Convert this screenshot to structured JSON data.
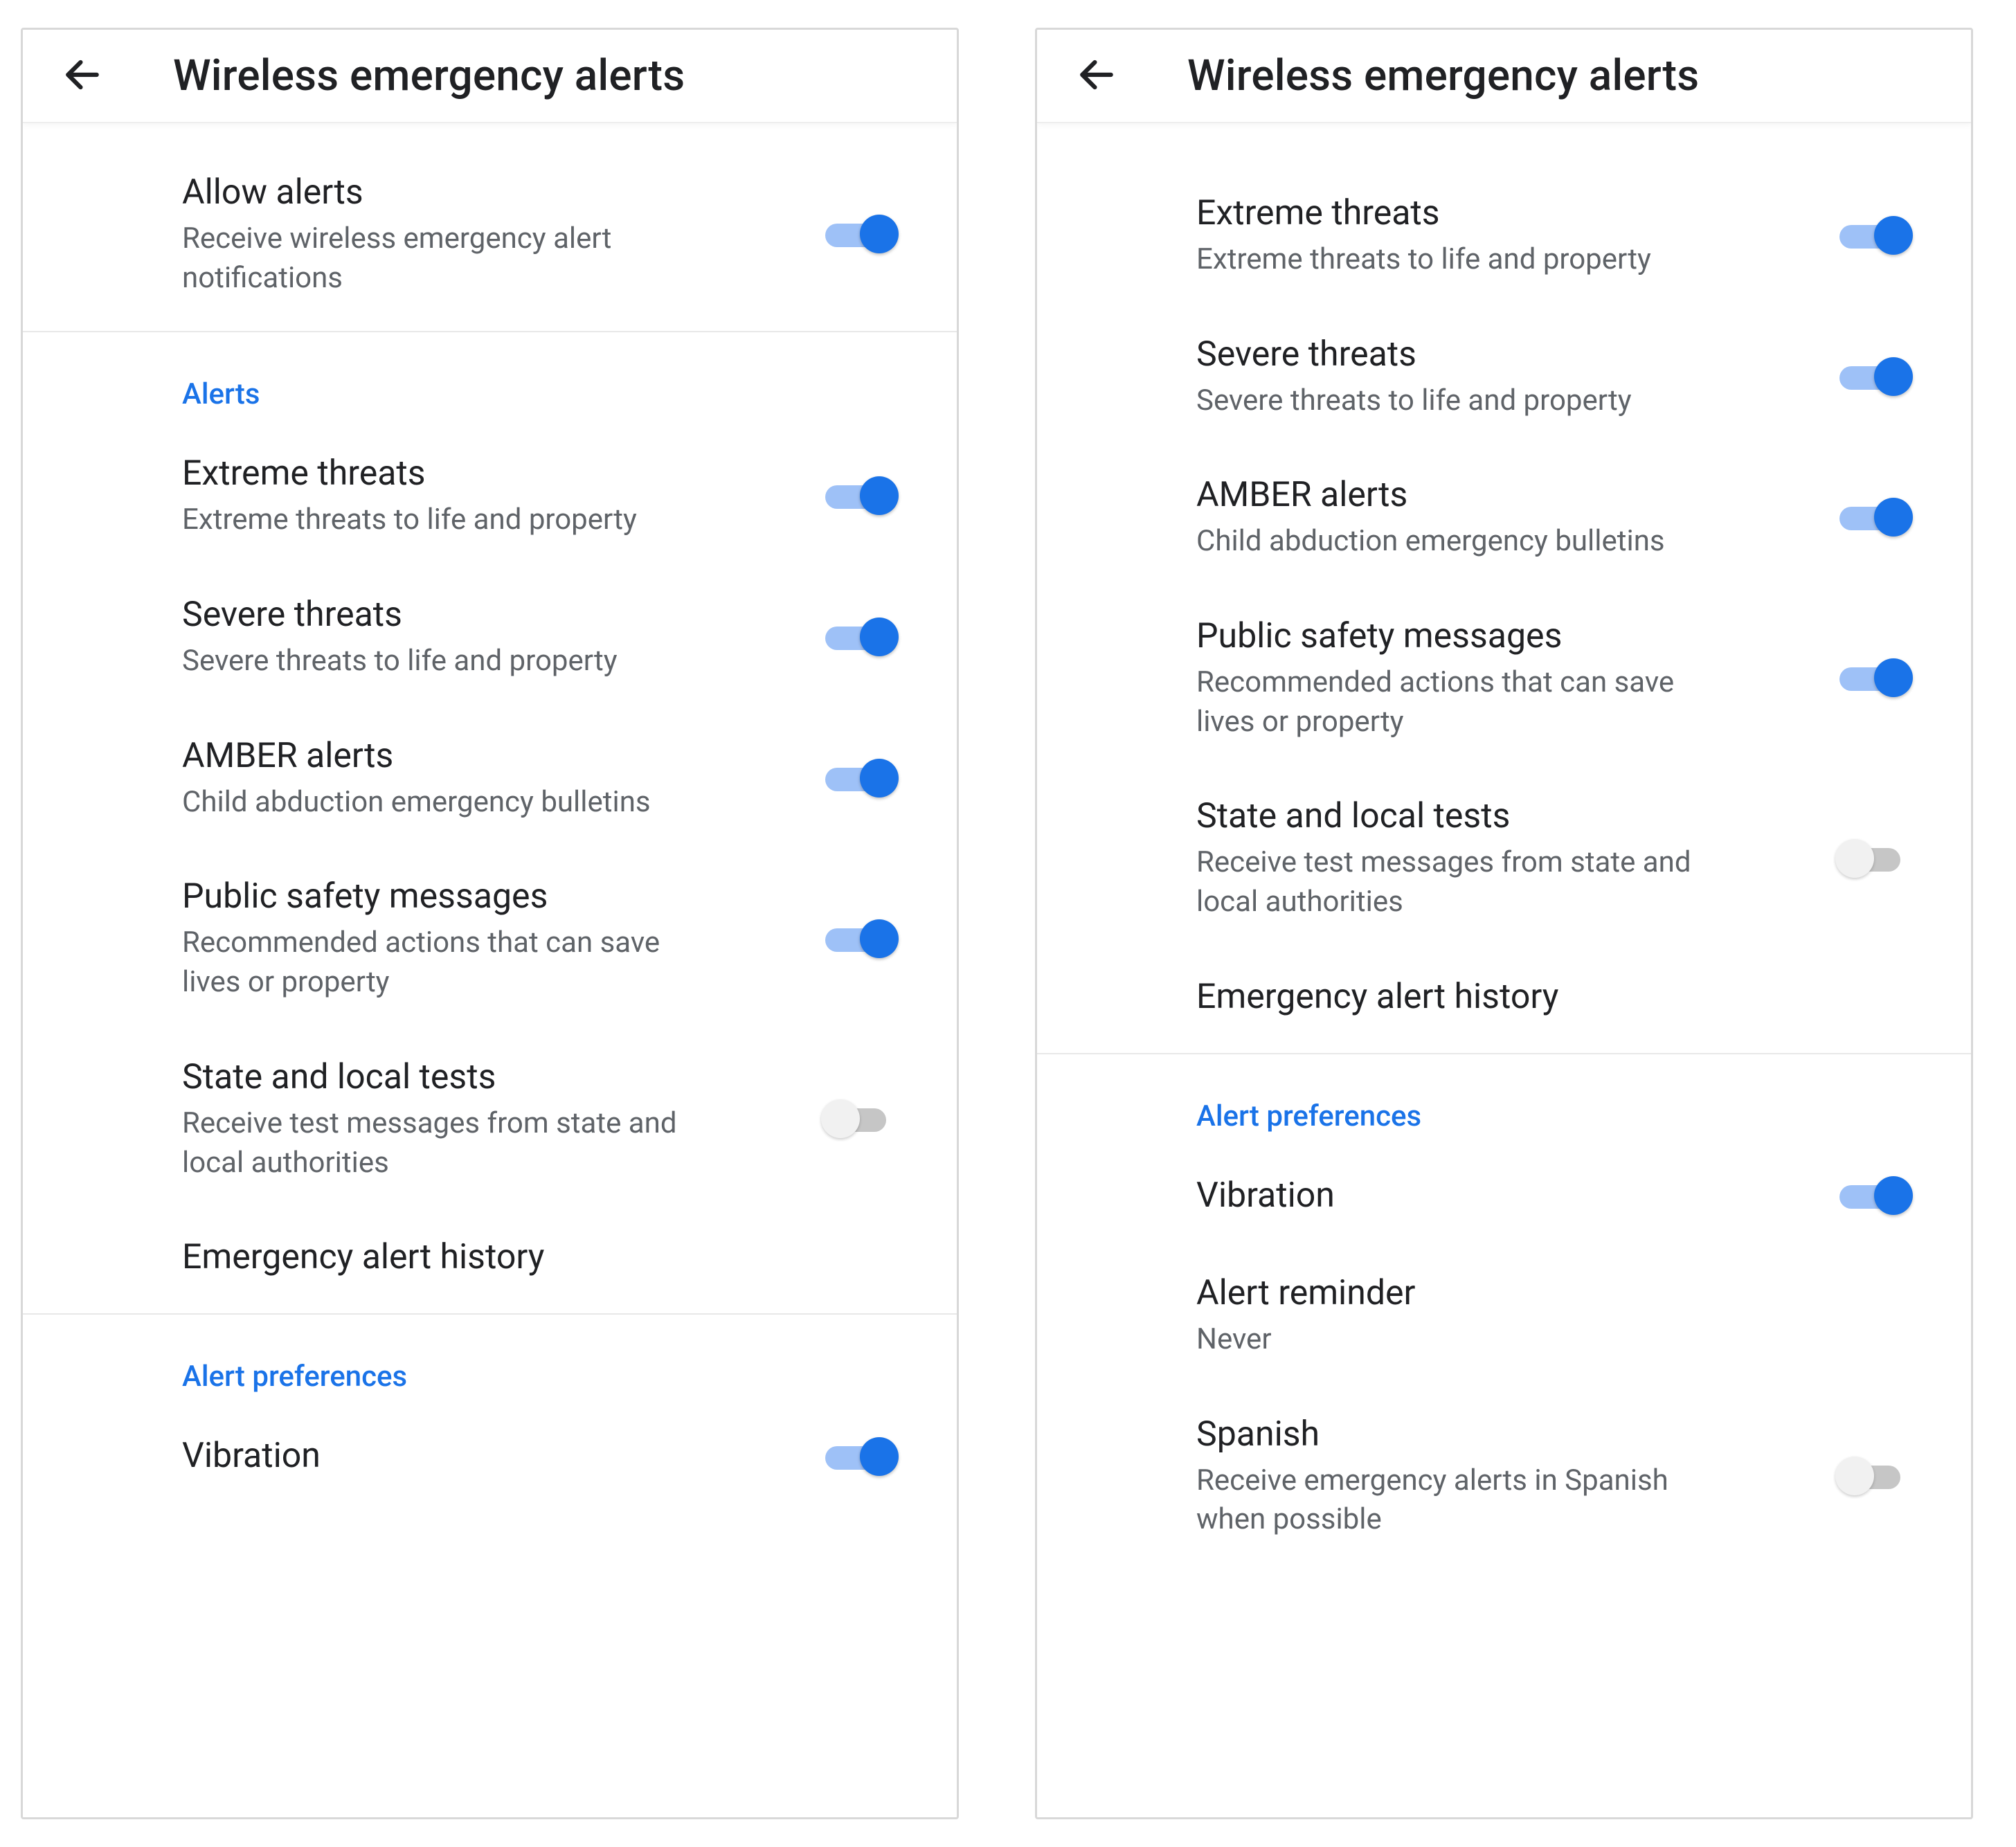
{
  "left": {
    "title": "Wireless emergency alerts",
    "allow": {
      "title": "Allow alerts",
      "sub": "Receive wireless emergency alert notifications",
      "on": true
    },
    "sec_alerts": "Alerts",
    "extreme": {
      "title": "Extreme threats",
      "sub": "Extreme threats to life and property",
      "on": true
    },
    "severe": {
      "title": "Severe threats",
      "sub": "Severe threats to life and property",
      "on": true
    },
    "amber": {
      "title": "AMBER alerts",
      "sub": "Child abduction emergency bulletins",
      "on": true
    },
    "psm": {
      "title": "Public safety messages",
      "sub": "Recommended actions that can save lives or property",
      "on": true
    },
    "tests": {
      "title": "State and local tests",
      "sub": "Receive test messages from state and local authorities",
      "on": false
    },
    "history": {
      "title": "Emergency alert history"
    },
    "sec_prefs": "Alert preferences",
    "vibration": {
      "title": "Vibration",
      "on": true
    }
  },
  "right": {
    "title": "Wireless emergency alerts",
    "extreme": {
      "title": "Extreme threats",
      "sub": "Extreme threats to life and property",
      "on": true
    },
    "severe": {
      "title": "Severe threats",
      "sub": "Severe threats to life and property",
      "on": true
    },
    "amber": {
      "title": "AMBER alerts",
      "sub": "Child abduction emergency bulletins",
      "on": true
    },
    "psm": {
      "title": "Public safety messages",
      "sub": "Recommended actions that can save lives or property",
      "on": true
    },
    "tests": {
      "title": "State and local tests",
      "sub": "Receive test messages from state and local authorities",
      "on": false
    },
    "history": {
      "title": "Emergency alert history"
    },
    "sec_prefs": "Alert preferences",
    "vibration": {
      "title": "Vibration",
      "on": true
    },
    "reminder": {
      "title": "Alert reminder",
      "sub": "Never"
    },
    "spanish": {
      "title": "Spanish",
      "sub": "Receive emergency alerts in Spanish when possible",
      "on": false
    }
  }
}
